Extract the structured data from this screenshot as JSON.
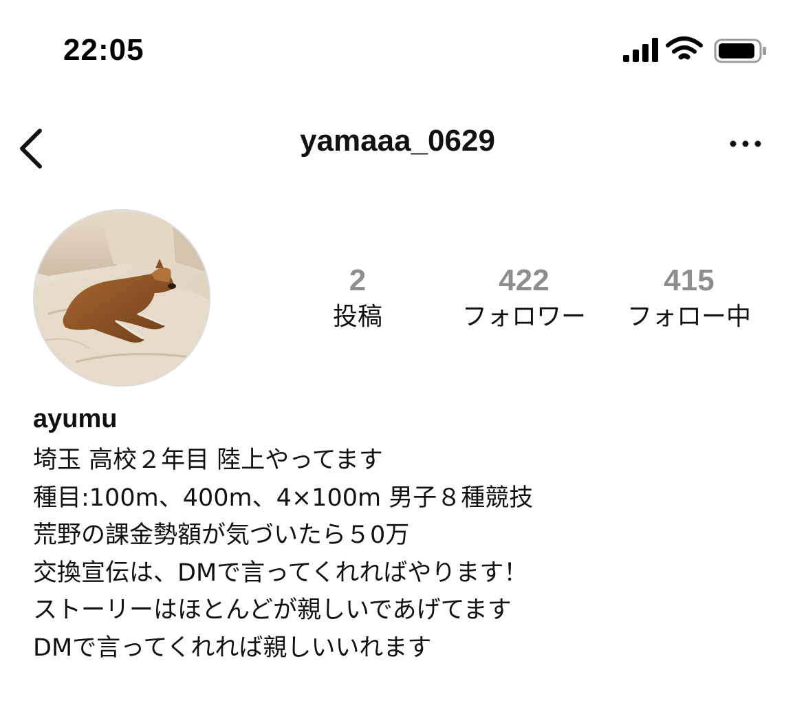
{
  "status_bar": {
    "time": "22:05",
    "icons": [
      "cellular-signal-icon",
      "wifi-icon",
      "battery-icon"
    ]
  },
  "nav": {
    "back_icon": "chevron-left-icon",
    "username": "yamaaa_0629",
    "more_icon": "more-horizontal-icon"
  },
  "profile": {
    "avatar": "profile-photo-dog-on-bed",
    "stats": [
      {
        "value": "2",
        "label": "投稿"
      },
      {
        "value": "422",
        "label": "フォロワー"
      },
      {
        "value": "415",
        "label": "フォロー中"
      }
    ],
    "name": "ayumu",
    "bio_lines": [
      "埼玉 高校２年目 陸上やってます",
      "種目:100m、400m、4×100m 男子８種競技",
      "荒野の課金勢額が気づいたら５0万",
      "交換宣伝は、DMで言ってくれればやります！",
      "ストーリーはほとんどが親しいであげてます",
      "DMで言ってくれれば親しいいれます"
    ]
  },
  "colors": {
    "stat_number": "#8e8e8e",
    "text": "#111111",
    "background": "#ffffff"
  }
}
